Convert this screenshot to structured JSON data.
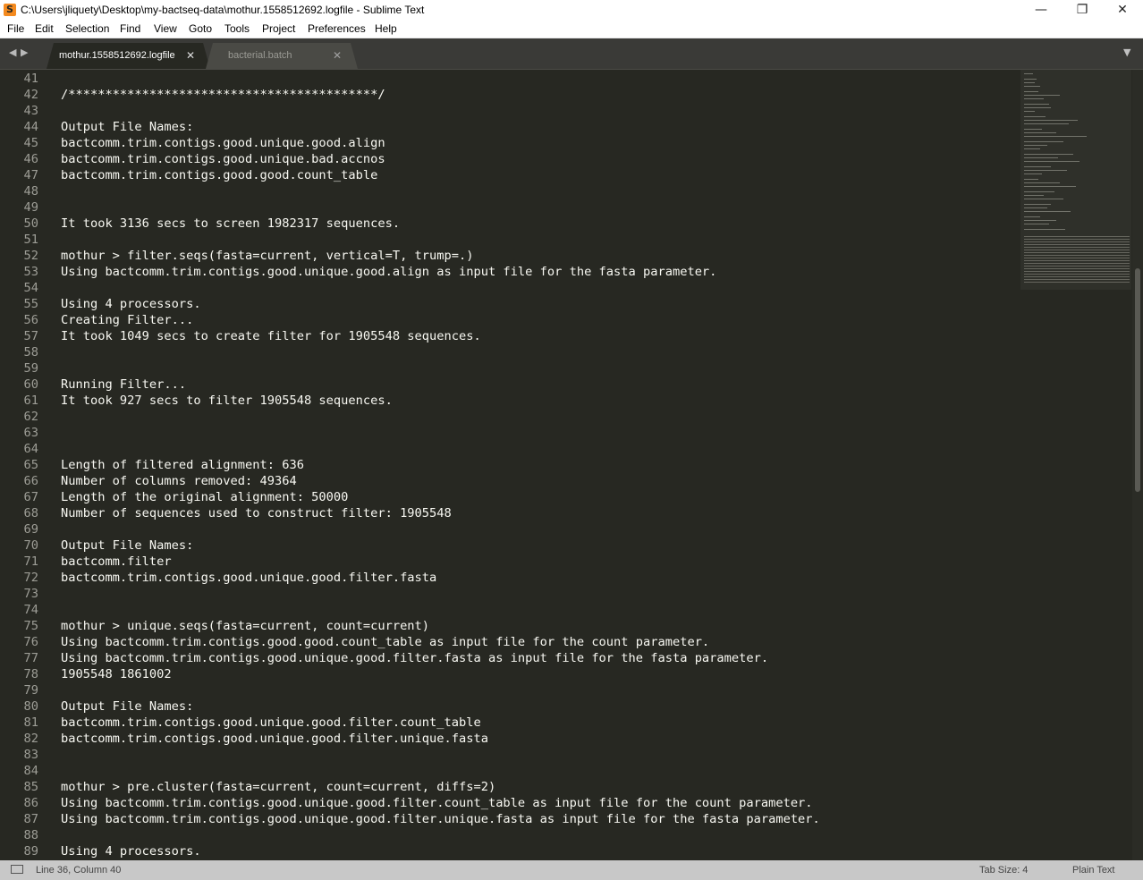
{
  "window": {
    "title": "C:\\Users\\jliquety\\Desktop\\my-bactseq-data\\mothur.1558512692.logfile - Sublime Text",
    "app_icon": "S",
    "minimize": "—",
    "maximize": "❐",
    "close": "✕"
  },
  "menu": [
    "File",
    "Edit",
    "Selection",
    "Find",
    "View",
    "Goto",
    "Tools",
    "Project",
    "Preferences",
    "Help"
  ],
  "tabs": {
    "back_icon": "◀",
    "forward_icon": "▶",
    "active": {
      "label": "mothur.1558512692.logfile",
      "close": "✕"
    },
    "inactive": {
      "label": "bacterial.batch",
      "close": "✕"
    },
    "dropdown_icon": "▼"
  },
  "editor": {
    "lines": [
      {
        "n": "41",
        "text": ""
      },
      {
        "n": "42",
        "text": "/******************************************/"
      },
      {
        "n": "43",
        "text": ""
      },
      {
        "n": "44",
        "text": "Output File Names:"
      },
      {
        "n": "45",
        "text": "bactcomm.trim.contigs.good.unique.good.align"
      },
      {
        "n": "46",
        "text": "bactcomm.trim.contigs.good.unique.bad.accnos"
      },
      {
        "n": "47",
        "text": "bactcomm.trim.contigs.good.good.count_table"
      },
      {
        "n": "48",
        "text": ""
      },
      {
        "n": "49",
        "text": ""
      },
      {
        "n": "50",
        "text": "It took 3136 secs to screen 1982317 sequences."
      },
      {
        "n": "51",
        "text": ""
      },
      {
        "n": "52",
        "text": "mothur > filter.seqs(fasta=current, vertical=T, trump=.)"
      },
      {
        "n": "53",
        "text": "Using bactcomm.trim.contigs.good.unique.good.align as input file for the fasta parameter."
      },
      {
        "n": "54",
        "text": ""
      },
      {
        "n": "55",
        "text": "Using 4 processors."
      },
      {
        "n": "56",
        "text": "Creating Filter..."
      },
      {
        "n": "57",
        "text": "It took 1049 secs to create filter for 1905548 sequences."
      },
      {
        "n": "58",
        "text": ""
      },
      {
        "n": "59",
        "text": ""
      },
      {
        "n": "60",
        "text": "Running Filter..."
      },
      {
        "n": "61",
        "text": "It took 927 secs to filter 1905548 sequences."
      },
      {
        "n": "62",
        "text": ""
      },
      {
        "n": "63",
        "text": ""
      },
      {
        "n": "64",
        "text": ""
      },
      {
        "n": "65",
        "text": "Length of filtered alignment: 636"
      },
      {
        "n": "66",
        "text": "Number of columns removed: 49364"
      },
      {
        "n": "67",
        "text": "Length of the original alignment: 50000"
      },
      {
        "n": "68",
        "text": "Number of sequences used to construct filter: 1905548"
      },
      {
        "n": "69",
        "text": ""
      },
      {
        "n": "70",
        "text": "Output File Names:"
      },
      {
        "n": "71",
        "text": "bactcomm.filter"
      },
      {
        "n": "72",
        "text": "bactcomm.trim.contigs.good.unique.good.filter.fasta"
      },
      {
        "n": "73",
        "text": ""
      },
      {
        "n": "74",
        "text": ""
      },
      {
        "n": "75",
        "text": "mothur > unique.seqs(fasta=current, count=current)"
      },
      {
        "n": "76",
        "text": "Using bactcomm.trim.contigs.good.good.count_table as input file for the count parameter."
      },
      {
        "n": "77",
        "text": "Using bactcomm.trim.contigs.good.unique.good.filter.fasta as input file for the fasta parameter."
      },
      {
        "n": "78",
        "text": "1905548 1861002"
      },
      {
        "n": "79",
        "text": ""
      },
      {
        "n": "80",
        "text": "Output File Names:"
      },
      {
        "n": "81",
        "text": "bactcomm.trim.contigs.good.unique.good.filter.count_table"
      },
      {
        "n": "82",
        "text": "bactcomm.trim.contigs.good.unique.good.filter.unique.fasta"
      },
      {
        "n": "83",
        "text": ""
      },
      {
        "n": "84",
        "text": ""
      },
      {
        "n": "85",
        "text": "mothur > pre.cluster(fasta=current, count=current, diffs=2)"
      },
      {
        "n": "86",
        "text": "Using bactcomm.trim.contigs.good.unique.good.filter.count_table as input file for the count parameter."
      },
      {
        "n": "87",
        "text": "Using bactcomm.trim.contigs.good.unique.good.filter.unique.fasta as input file for the fasta parameter."
      },
      {
        "n": "88",
        "text": ""
      },
      {
        "n": "89",
        "text": "Using 4 processors."
      }
    ]
  },
  "status": {
    "cursor": "Line 36, Column 40",
    "tab_size": "Tab Size: 4",
    "syntax": "Plain Text"
  },
  "colors": {
    "editor_bg": "#272822",
    "text": "#f8f8f2",
    "line_numbers": "#9d9d96",
    "app_icon": "#f48a1f"
  }
}
